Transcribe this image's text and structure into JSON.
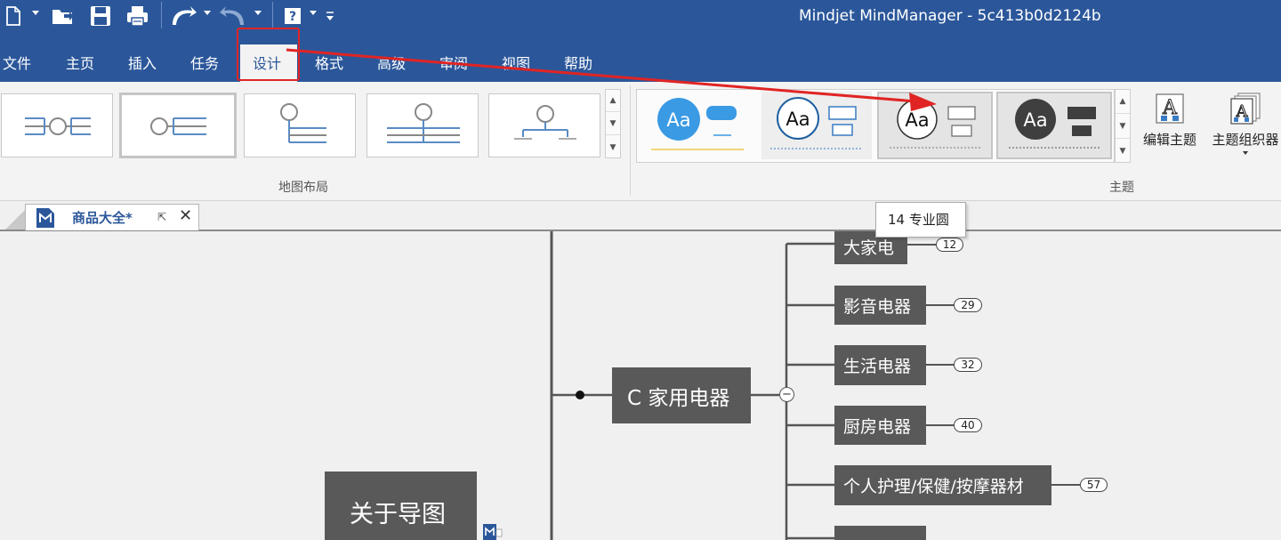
{
  "app": {
    "window_title": "Mindjet MindManager - 5c413b0d2124b"
  },
  "quick_access": {
    "icons": [
      "new-document-icon",
      "open-folder-icon",
      "save-icon",
      "print-icon",
      "undo-icon",
      "redo-icon",
      "help-icon",
      "customize-icon"
    ]
  },
  "menu": {
    "tabs": [
      {
        "label": "文件"
      },
      {
        "label": "主页"
      },
      {
        "label": "插入"
      },
      {
        "label": "任务"
      },
      {
        "label": "设计"
      },
      {
        "label": "格式"
      },
      {
        "label": "高级"
      },
      {
        "label": "审阅"
      },
      {
        "label": "视图"
      },
      {
        "label": "帮助"
      }
    ],
    "active_tab": "设计"
  },
  "ribbon": {
    "layout_group_label": "地图布局",
    "theme_group_label": "主题",
    "theme_tiles": [
      {
        "sample": "Aa"
      },
      {
        "sample": "Aa"
      },
      {
        "sample": "Aa"
      },
      {
        "sample": "Aa"
      }
    ],
    "edit_theme_label": "编辑主题",
    "theme_organizer_label": "主题组织器"
  },
  "tooltip": {
    "text": "14 专业圆"
  },
  "document_tab": {
    "label": "商品大全*"
  },
  "map": {
    "central_topic": "关于导图",
    "main_topic": "C 家用电器",
    "collapse_symbol": "−",
    "subtopics": [
      {
        "label": "大家电",
        "count": "12"
      },
      {
        "label": "影音电器",
        "count": "29"
      },
      {
        "label": "生活电器",
        "count": "32"
      },
      {
        "label": "厨房电器",
        "count": "40"
      },
      {
        "label": "个人护理/保健/按摩器材",
        "count": "57"
      }
    ]
  },
  "colors": {
    "title_bar": "#2b579a",
    "topic_fill": "#595959",
    "annotation_red": "#e02424"
  }
}
